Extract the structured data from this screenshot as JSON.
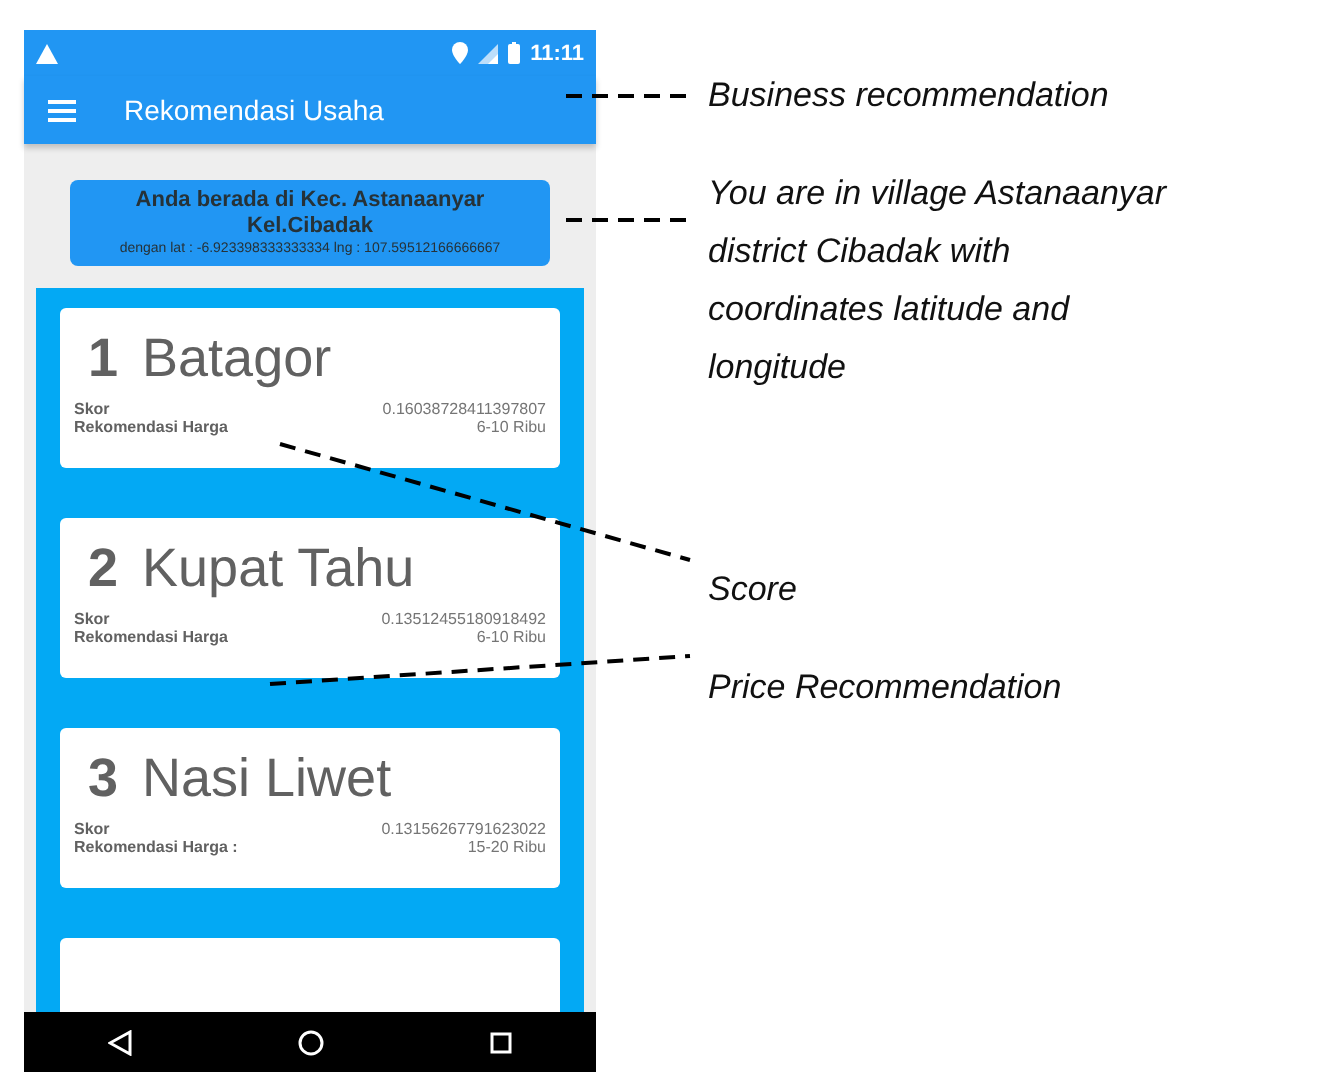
{
  "status_bar": {
    "time": "11:11"
  },
  "app_bar": {
    "title": "Rekomendasi Usaha"
  },
  "location": {
    "title": "Anda berada di Kec.  Astanaanyar Kel.Cibadak",
    "coords": "dengan lat : -6.923398333333334 lng : 107.59512166666667"
  },
  "cards": [
    {
      "kind": "item",
      "rank": "1",
      "name": "Batagor",
      "score_label": "Skor",
      "score": "0.16038728411397807",
      "price_label": "Rekomendasi Harga",
      "price": "6-10 Ribu"
    },
    {
      "kind": "item",
      "rank": "2",
      "name": "Kupat Tahu",
      "score_label": "Skor",
      "score": "0.13512455180918492",
      "price_label": "Rekomendasi Harga",
      "price": "6-10 Ribu"
    },
    {
      "kind": "item",
      "rank": "3",
      "name": "Nasi Liwet",
      "score_label": "Skor",
      "score": "0.13156267791623022",
      "price_label": "Rekomendasi Harga :",
      "price": "15-20 Ribu"
    },
    {
      "kind": "empty"
    }
  ],
  "annotations": [
    {
      "lines": [
        "Business recommendation"
      ]
    },
    {
      "lines": [
        "You are in village Astanaanyar",
        "district Cibadak with",
        "coordinates latitude and",
        "longitude"
      ]
    },
    {
      "lines": [
        "Score"
      ]
    },
    {
      "lines": [
        "Price Recommendation"
      ]
    }
  ]
}
